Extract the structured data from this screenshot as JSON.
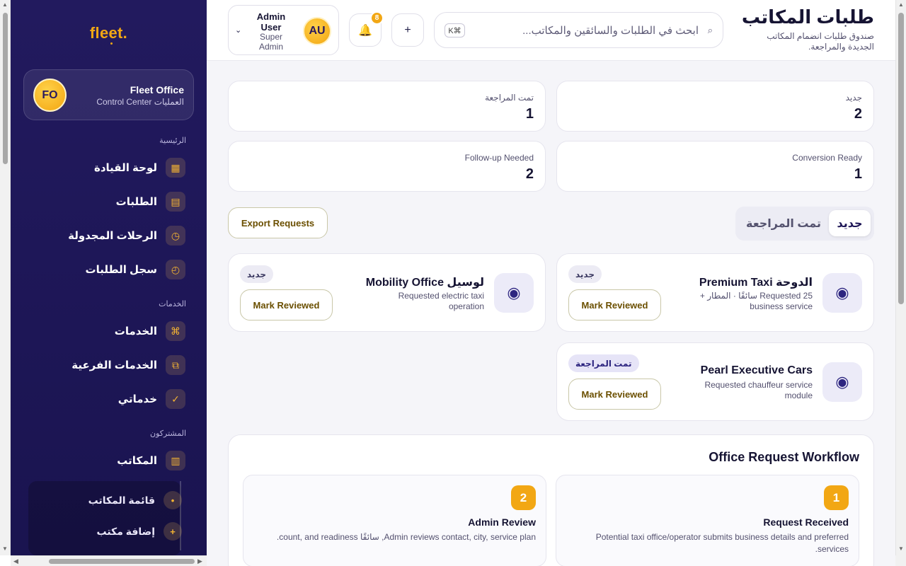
{
  "sidebar": {
    "logo": "fleet.",
    "office": {
      "initials": "FO",
      "name": "Fleet Office",
      "subtitle": "العمليات Control Center"
    },
    "sections": {
      "main": "الرئيسية",
      "services": "الخدمات",
      "subscribers": "المشتركون"
    },
    "items": [
      {
        "label": "لوحة القيادة",
        "icon": "dashboard-icon",
        "glyph": "▦"
      },
      {
        "label": "الطلبات",
        "icon": "orders-icon",
        "glyph": "▤"
      },
      {
        "label": "الرحلات المجدولة",
        "icon": "clock-icon",
        "glyph": "◷"
      },
      {
        "label": "سجل الطلبات",
        "icon": "history-icon",
        "glyph": "◴"
      },
      {
        "label": "الخدمات",
        "icon": "command-icon",
        "glyph": "⌘"
      },
      {
        "label": "الخدمات الفرعية",
        "icon": "copy-icon",
        "glyph": "⧉"
      },
      {
        "label": "خدماتي",
        "icon": "check-icon",
        "glyph": "✓"
      },
      {
        "label": "المكاتب",
        "icon": "office-icon",
        "glyph": "▥"
      }
    ],
    "subitems": [
      {
        "label": "قائمة المكاتب",
        "glyph": "•"
      },
      {
        "label": "إضافة مكتب",
        "glyph": "+"
      }
    ]
  },
  "header": {
    "title": "طلبات المكاتب",
    "subtitle": "صندوق طلبات انضمام المكاتب الجديدة والمراجعة.",
    "search_placeholder": "ابحث في الطلبات والسائقين والمكاتب...",
    "search_shortcut": "K⌘",
    "notifications_count": "8",
    "user": {
      "initials": "AU",
      "name": "Admin User",
      "role": "Super Admin"
    }
  },
  "stats": [
    {
      "label": "جديد",
      "value": "2"
    },
    {
      "label": "تمت المراجعة",
      "value": "1"
    },
    {
      "label": "Conversion Ready",
      "value": "1"
    },
    {
      "label": "Follow-up Needed",
      "value": "2"
    }
  ],
  "tabs": {
    "active": "جديد",
    "reviewed": "تمت المراجعة"
  },
  "export_label": "Export Requests",
  "requests": [
    {
      "title": "الدوحة Premium Taxi",
      "desc": "Requested 25 سائقًا · المطار + business service",
      "status": "جديد",
      "action": "Mark Reviewed"
    },
    {
      "title": "لوسيل Mobility Office",
      "desc": "Requested electric taxi operation",
      "status": "جديد",
      "action": "Mark Reviewed"
    },
    {
      "title": "Pearl Executive Cars",
      "desc": "Requested chauffeur service module",
      "status": "تمت المراجعة",
      "action": "Mark Reviewed"
    }
  ],
  "workflow": {
    "title": "Office Request Workflow",
    "steps": [
      {
        "num": "1",
        "title": "Request Received",
        "desc": "Potential taxi office/operator submits business details and preferred services."
      },
      {
        "num": "2",
        "title": "Admin Review",
        "desc": "Admin reviews contact, city, service plan, سائقًا count, and readiness."
      }
    ]
  },
  "colors": {
    "sidebar": "#1d1656",
    "accent": "#f2a714",
    "text": "#161433"
  }
}
